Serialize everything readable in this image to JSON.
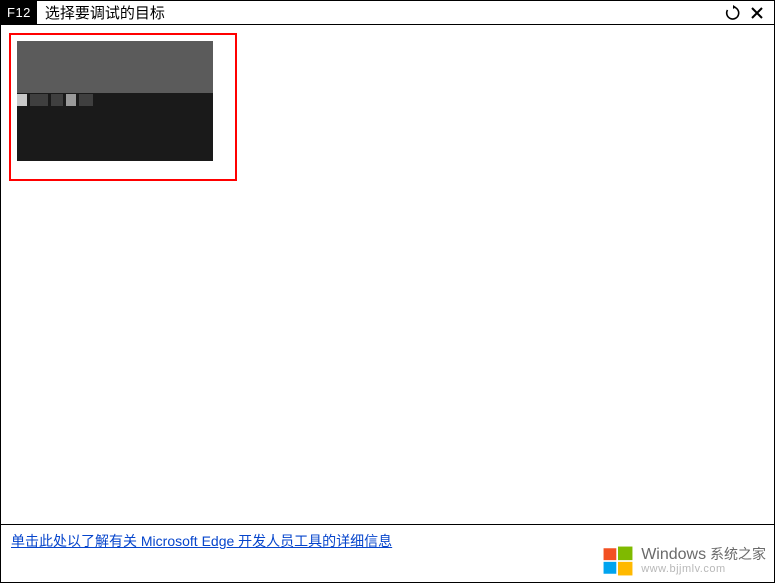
{
  "titlebar": {
    "badge": "F12",
    "title": "选择要调试的目标",
    "refresh_icon": "refresh-icon",
    "close_icon": "close-icon"
  },
  "targets": [
    {
      "id": "target-0",
      "thumb": "redacted"
    }
  ],
  "footer": {
    "link_text": "单击此处以了解有关 Microsoft Edge 开发人员工具的详细信息"
  },
  "watermark": {
    "brand": "Windows",
    "suffix": "系统之家",
    "url": "www.bjjmlv.com"
  },
  "colors": {
    "highlight_border": "#ff0000",
    "link": "#0645cc"
  }
}
